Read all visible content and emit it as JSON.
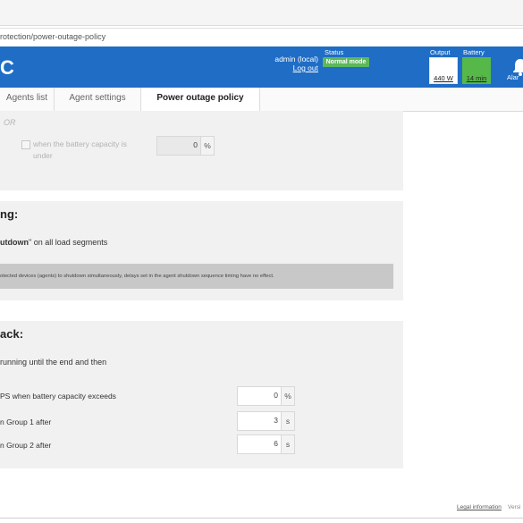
{
  "browser": {
    "url": "rotection/power-outage-policy"
  },
  "header": {
    "brand": "C",
    "user": "admin (local)",
    "logout": "Log out",
    "status_label": "Status",
    "status_value": "Normal mode",
    "output_label": "Output",
    "output_value": "440 W",
    "battery_label": "Battery",
    "battery_value": "14 min",
    "alarms_label": "Alar"
  },
  "tabs": [
    {
      "label": "Agents list",
      "active": false
    },
    {
      "label": "Agent settings",
      "active": false
    },
    {
      "label": "Power outage policy",
      "active": true
    }
  ],
  "section1": {
    "or": "OR",
    "battery_checkbox_label": "when the battery capacity is under",
    "battery_value": "0",
    "battery_unit": "%"
  },
  "section2": {
    "title": "ng:",
    "line_bold": "utdown",
    "line_rest": "\" on all load segments",
    "note": "otected devices (agents) to shutdown simultaneously, delays set in the agent shutdown sequence timing have no effect."
  },
  "section3": {
    "title": "ack:",
    "line": "running until the end and then",
    "rows": [
      {
        "label": "PS when battery capacity exceeds",
        "value": "0",
        "unit": "%"
      },
      {
        "label": "n Group 1 after",
        "value": "3",
        "unit": "s"
      },
      {
        "label": "n Group 2 after",
        "value": "6",
        "unit": "s"
      }
    ]
  },
  "footer": {
    "legal": "Legal information",
    "version": "Versi"
  },
  "colors": {
    "header_blue": "#1f6dc5",
    "status_green": "#5cb85c",
    "battery_green": "#56b848",
    "panel_bg": "#f1f1f1"
  }
}
